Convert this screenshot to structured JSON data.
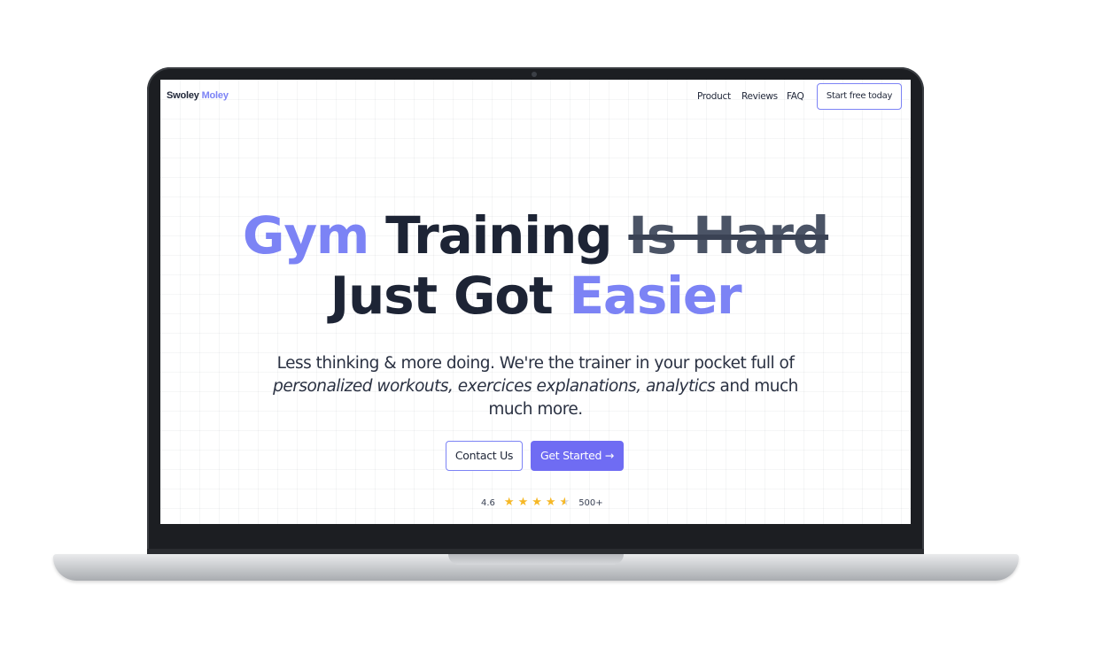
{
  "brand": {
    "name_part1": "Swoley",
    "name_part2": "Moley"
  },
  "nav": {
    "links": [
      "Product",
      "Reviews",
      "FAQ"
    ],
    "cta": "Start free today"
  },
  "hero": {
    "line1_accent": "Gym",
    "line1_text": "Training",
    "line1_strike": "Is Hard",
    "line2_text": "Just Got",
    "line2_accent": "Easier",
    "subtitle_start": "Less thinking & more doing. We're the trainer in your pocket full of",
    "subtitle_italic": "personalized workouts, exercices explanations, analytics",
    "subtitle_end": "and much much more."
  },
  "buttons": {
    "contact": "Contact Us",
    "get_started": "Get Started →"
  },
  "rating": {
    "score": "4.6",
    "value": 4.6,
    "max": 5,
    "count": "500+"
  },
  "colors": {
    "accent": "#7c83f5",
    "primary_button": "#6f6cf3",
    "dark_text": "#1d2435",
    "star": "#f6b826"
  }
}
